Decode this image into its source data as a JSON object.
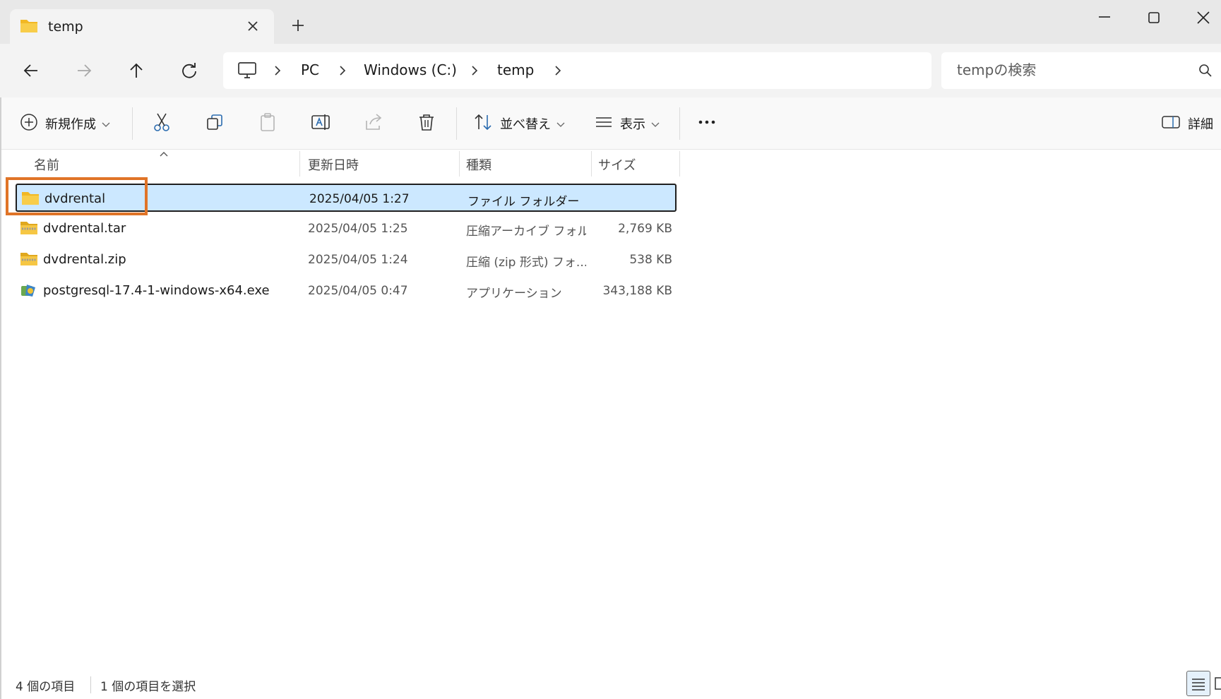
{
  "tab": {
    "title": "temp"
  },
  "breadcrumb": [
    "PC",
    "Windows (C:)",
    "temp"
  ],
  "search": {
    "placeholder": "tempの検索"
  },
  "toolbar": {
    "new_label": "新規作成",
    "sort_label": "並べ替え",
    "view_label": "表示",
    "details_label": "詳細"
  },
  "columns": {
    "name": "名前",
    "date": "更新日時",
    "type": "種類",
    "size": "サイズ"
  },
  "files": [
    {
      "name": "dvdrental",
      "date": "2025/04/05 1:27",
      "type": "ファイル フォルダー",
      "size": "",
      "icon": "folder-icon",
      "selected": true
    },
    {
      "name": "dvdrental.tar",
      "date": "2025/04/05 1:25",
      "type": "圧縮アーカイブ フォル...",
      "size": "2,769 KB",
      "icon": "archive-folder-icon",
      "selected": false
    },
    {
      "name": "dvdrental.zip",
      "date": "2025/04/05 1:24",
      "type": "圧縮 (zip 形式) フォ...",
      "size": "538 KB",
      "icon": "zip-folder-icon",
      "selected": false
    },
    {
      "name": "postgresql-17.4-1-windows-x64.exe",
      "date": "2025/04/05 0:47",
      "type": "アプリケーション",
      "size": "343,188 KB",
      "icon": "installer-icon",
      "selected": false
    }
  ],
  "status": {
    "count": "4 個の項目",
    "selected": "1 個の項目を選択"
  },
  "colors": {
    "selection": "#cce8ff",
    "highlight": "#e07427",
    "folder": "#f8c636"
  }
}
